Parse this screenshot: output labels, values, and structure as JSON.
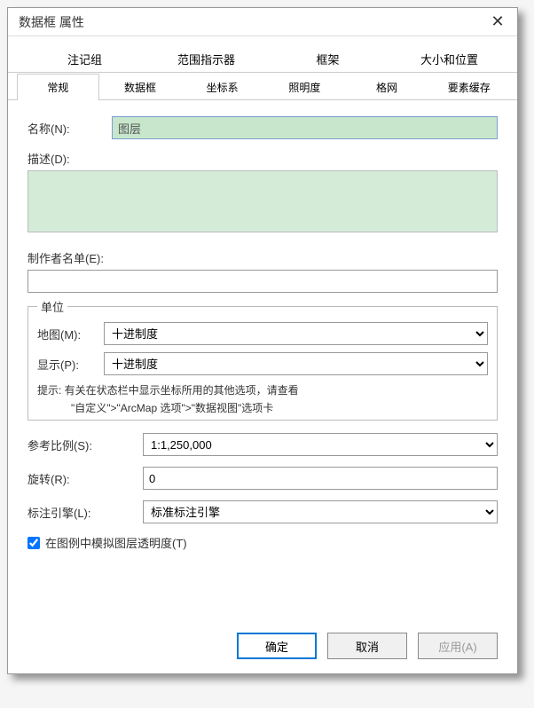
{
  "title": "数据框 属性",
  "tabs_row1": [
    "注记组",
    "范围指示器",
    "框架",
    "大小和位置"
  ],
  "tabs_row2": [
    "常规",
    "数据框",
    "坐标系",
    "照明度",
    "格网",
    "要素缓存"
  ],
  "active_tab": "常规",
  "name": {
    "label": "名称(N):",
    "value": "图层"
  },
  "desc": {
    "label": "描述(D):"
  },
  "cred": {
    "label": "制作者名单(E):"
  },
  "units": {
    "legend": "单位",
    "map": {
      "label": "地图(M):",
      "value": "十进制度"
    },
    "disp": {
      "label": "显示(P):",
      "value": "十进制度"
    },
    "hint1": "提示: 有关在状态栏中显示坐标所用的其他选项，请查看",
    "hint2": "\"自定义\">\"ArcMap 选项\">\"数据视图\"选项卡"
  },
  "ref_scale": {
    "label": "参考比例(S):",
    "value": "1:1,250,000"
  },
  "rotate": {
    "label": "旋转(R):",
    "value": "0"
  },
  "label_engine": {
    "label": "标注引擎(L):",
    "value": "标准标注引擎"
  },
  "checkbox": {
    "label": "在图例中模拟图层透明度(T)"
  },
  "buttons": {
    "ok": "确定",
    "cancel": "取消",
    "apply": "应用(A)"
  }
}
